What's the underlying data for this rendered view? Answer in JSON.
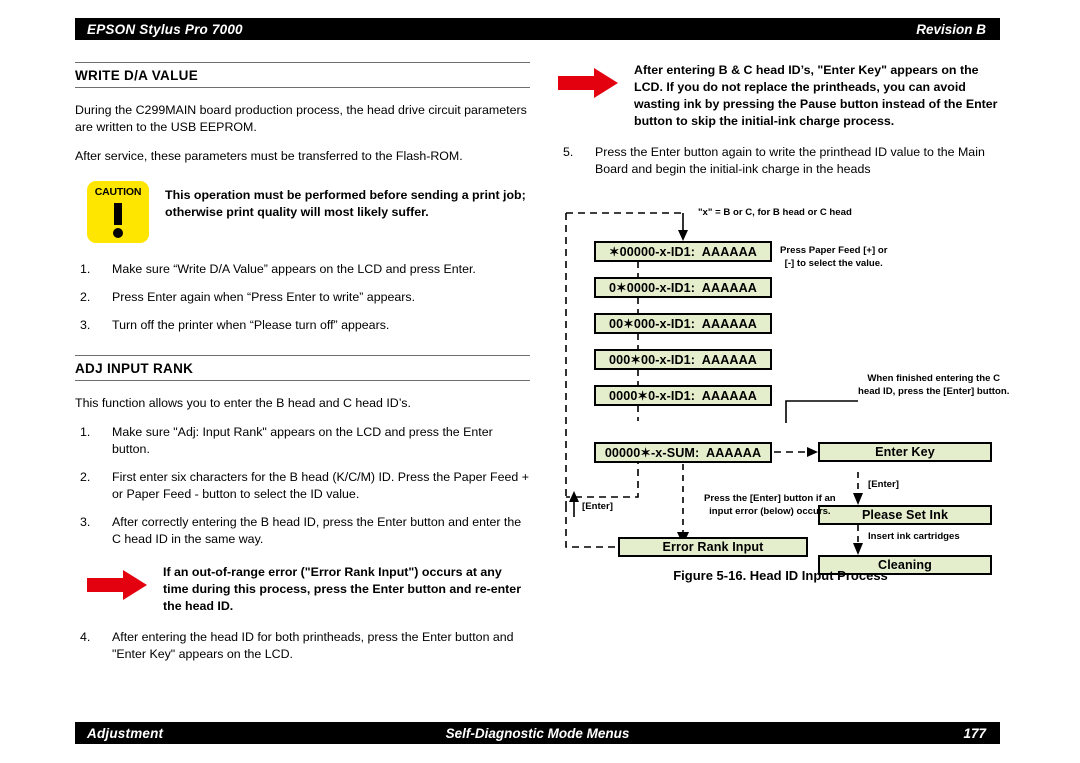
{
  "header": {
    "product": "EPSON Stylus Pro 7000",
    "revision": "Revision B"
  },
  "footer": {
    "left": "Adjustment",
    "center": "Self-Diagnostic Mode Menus",
    "page": "177"
  },
  "left_column": {
    "section1": {
      "heading": "WRITE D/A VALUE",
      "paragraphs": [
        "During the C299MAIN board production process, the head drive circuit parameters are written to the USB EEPROM.",
        "After service, these parameters must be transferred to the Flash-ROM."
      ],
      "caution": {
        "icon_label": "CAUTION",
        "text": "This operation must be performed before sending a print job; otherwise print quality will most likely suffer."
      },
      "steps": [
        {
          "num": "1.",
          "text": "Make sure “Write D/A Value” appears on the LCD and press Enter."
        },
        {
          "num": "2.",
          "text": "Press Enter again when “Press Enter to write” appears."
        },
        {
          "num": "3.",
          "text": "Turn off the printer when “Please turn off” appears."
        }
      ]
    },
    "section2": {
      "heading": "ADJ INPUT RANK",
      "intro": "This function allows you to enter the B head and C head ID’s.",
      "steps_a": [
        {
          "num": "1.",
          "text": "Make sure \"Adj: Input Rank\" appears on the LCD and press the Enter button."
        },
        {
          "num": "2.",
          "text": "First enter six characters for the B head (K/C/M) ID. Press the Paper Feed + or Paper Feed - button to select the ID value."
        },
        {
          "num": "3.",
          "text": "After correctly entering the B head ID, press the Enter button and enter the C head ID in the same way."
        }
      ],
      "arrow_note": "If an out-of-range error (\"Error Rank Input\") occurs at any time during this process, press the Enter button and re-enter the head ID.",
      "steps_b": [
        {
          "num": "4.",
          "text": "After entering the head ID for both printheads, press the Enter button and \"Enter Key\" appears on the LCD."
        }
      ]
    }
  },
  "right_column": {
    "arrow_note": "After entering B & C head ID’s, \"Enter Key\" appears on the LCD. If you do not replace the printheads, you can avoid wasting ink by pressing the Pause button instead of the Enter button to skip the initial-ink charge process.",
    "steps": [
      {
        "num": "5.",
        "text": "Press the Enter button again to write the printhead ID value to the Main Board and begin the initial-ink charge in the heads"
      }
    ],
    "figure_caption": "Figure 5-16.  Head ID Input Process"
  },
  "flowchart": {
    "note_top": "\"x\" = B or C, for B head or C head",
    "note_paperfeed": "Press Paper Feed [+] or\n[-] to select the value.",
    "note_finished": "When finished entering the C\nhead ID, press the [Enter] button.",
    "note_enter_error": "Press the [Enter] button if an\ninput error (below) occurs.",
    "label_enter": "[Enter]",
    "label_enter2": "[Enter]",
    "label_insert_ink": "Insert ink cartridges",
    "lcd_boxes": [
      "✶00000-x-ID1:  AAAAAA",
      "0✶0000-x-ID1:  AAAAAA",
      "00✶000-x-ID1:  AAAAAA",
      "000✶00-x-ID1:  AAAAAA",
      "0000✶0-x-ID1:  AAAAAA",
      "00000✶-x-SUM:  AAAAAA"
    ],
    "right_boxes": [
      "Enter Key",
      "Please Set Ink",
      "Cleaning"
    ],
    "error_box": "Error Rank Input",
    "box_fill": "#e4eecd",
    "box_border": "#000000"
  }
}
